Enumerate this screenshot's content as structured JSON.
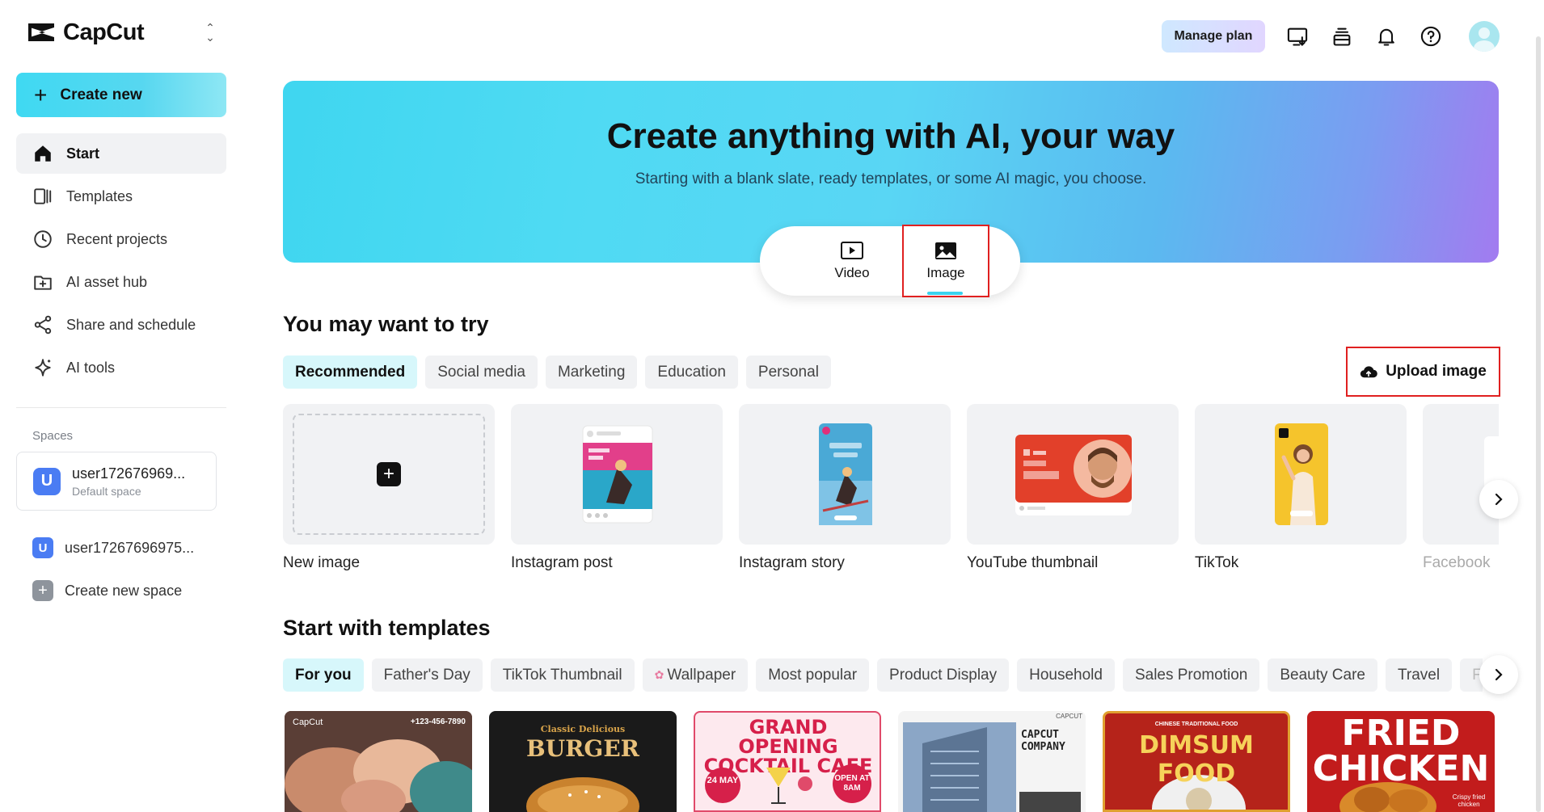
{
  "app": {
    "name": "CapCut"
  },
  "sidebar": {
    "create_new": "Create new",
    "items": [
      {
        "label": "Start",
        "icon": "home-icon",
        "active": true
      },
      {
        "label": "Templates",
        "icon": "templates-icon"
      },
      {
        "label": "Recent projects",
        "icon": "clock-icon"
      },
      {
        "label": "AI asset hub",
        "icon": "asset-hub-icon"
      },
      {
        "label": "Share and schedule",
        "icon": "share-icon"
      },
      {
        "label": "AI tools",
        "icon": "sparkle-icon"
      }
    ],
    "spaces_title": "Spaces",
    "current_space": {
      "name": "user172676969...",
      "sub": "Default space",
      "initial": "U"
    },
    "other_space": {
      "name": "user17267696975...",
      "initial": "U"
    },
    "create_space": "Create new space"
  },
  "topbar": {
    "manage_plan": "Manage plan"
  },
  "hero": {
    "title": "Create anything with AI, your way",
    "subtitle": "Starting with a blank slate, ready templates, or some AI magic, you choose.",
    "modes": [
      {
        "label": "Video",
        "icon": "video-icon"
      },
      {
        "label": "Image",
        "icon": "image-icon",
        "selected": true
      }
    ]
  },
  "try_section": {
    "title": "You may want to try",
    "chips": [
      "Recommended",
      "Social media",
      "Marketing",
      "Education",
      "Personal"
    ],
    "upload": "Upload image",
    "cards": [
      "New image",
      "Instagram post",
      "Instagram story",
      "YouTube thumbnail",
      "TikTok",
      "Facebook"
    ]
  },
  "templates_section": {
    "title": "Start with templates",
    "chips": [
      "For you",
      "Father's Day",
      "TikTok Thumbnail",
      "Wallpaper",
      "Most popular",
      "Product Display",
      "Household",
      "Sales Promotion",
      "Beauty Care",
      "Travel",
      "Fo"
    ],
    "tiles": {
      "t1_brand": "CapCut",
      "t1_phone": "+123-456-7890",
      "t2_top": "Classic Delicious",
      "t2_main": "BURGER",
      "t3_main": "GRAND OPENING COCKTAIL CAFE",
      "t3_date": "24 MAY",
      "t3_open": "OPEN AT 8AM",
      "t4_brand": "CAPCUT",
      "t4_main": "CAPCUT COMPANY",
      "t5_top": "CHINESE TRADITIONAL FOOD",
      "t5_main": "DIMSUM FOOD",
      "t6_main": "FRIED CHICKEN",
      "t6_sub": "Crispy fried chicken"
    }
  },
  "colors": {
    "accent": "#3fd9f2",
    "highlight": "#e02020"
  }
}
